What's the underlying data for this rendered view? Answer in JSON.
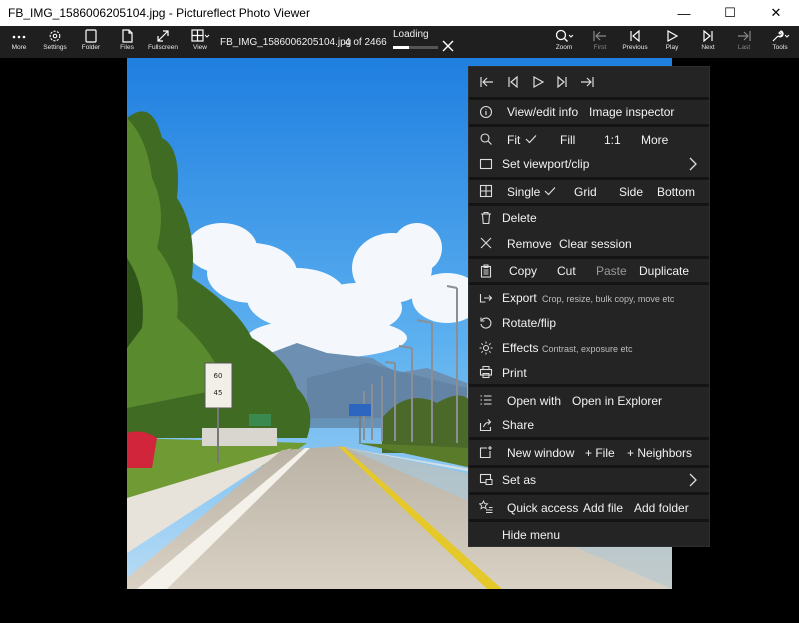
{
  "window": {
    "title": "FB_IMG_1586006205104.jpg - Pictureflect Photo Viewer",
    "minimize": "—",
    "maximize": "☐",
    "close": "✕"
  },
  "toolbar": {
    "more": "More",
    "settings": "Settings",
    "folder": "Folder",
    "files": "Files",
    "fullscreen": "Fullscreen",
    "view": "View",
    "filename": "FB_IMG_1586006205104.jpg",
    "counter": "4 of 2466",
    "loading": "Loading",
    "zoom": "Zoom",
    "first": "First",
    "previous": "Previous",
    "play": "Play",
    "next": "Next",
    "last": "Last",
    "tools": "Tools"
  },
  "menu": {
    "view_info": "View/edit info",
    "image_inspector": "Image inspector",
    "fit": "Fit",
    "fill": "Fill",
    "one_to_one": "1:1",
    "more": "More",
    "set_viewport": "Set viewport/clip",
    "single": "Single",
    "grid": "Grid",
    "side": "Side",
    "bottom": "Bottom",
    "delete": "Delete",
    "remove": "Remove",
    "clear_session": "Clear session",
    "copy": "Copy",
    "cut": "Cut",
    "paste": "Paste",
    "duplicate": "Duplicate",
    "export": "Export",
    "export_desc": "Crop, resize, bulk copy, move etc",
    "rotate_flip": "Rotate/flip",
    "effects": "Effects",
    "effects_desc": "Contrast, exposure etc",
    "print": "Print",
    "open_with": "Open with",
    "open_in_explorer": "Open in Explorer",
    "share": "Share",
    "new_window": "New window",
    "plus_file": "+ File",
    "plus_neighbors": "+ Neighbors",
    "set_as": "Set as",
    "quick_access": "Quick access",
    "add_file": "Add file",
    "add_folder": "Add folder",
    "hide_menu": "Hide menu"
  },
  "photo_sign": {
    "top": "60",
    "bottom": "45"
  },
  "loading_progress": 0.35,
  "colors": {
    "menu_bg": "#242424",
    "toolbar_bg": "#1f1f1f",
    "sky": "#2f8de0"
  }
}
